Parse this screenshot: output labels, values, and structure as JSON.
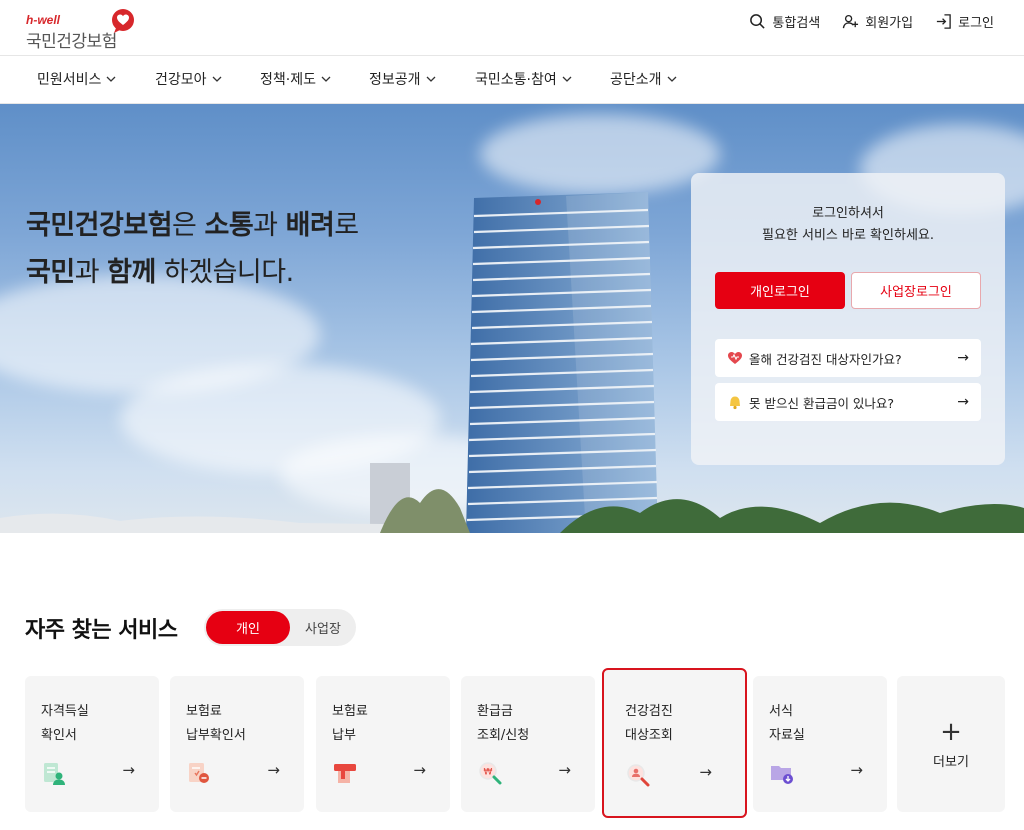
{
  "header": {
    "logo_en": "h-well",
    "logo_ko": "국민건강보험",
    "utility": [
      {
        "label": "통합검색",
        "icon": "search-icon"
      },
      {
        "label": "회원가입",
        "icon": "user-add-icon"
      },
      {
        "label": "로그인",
        "icon": "login-icon"
      }
    ]
  },
  "nav": [
    "민원서비스",
    "건강모아",
    "정책·제도",
    "정보공개",
    "국민소통·참여",
    "공단소개"
  ],
  "hero": {
    "line1": {
      "a": "국민건강보험",
      "b": "은 ",
      "c": "소통",
      "d": "과 ",
      "e": "배려",
      "f": "로"
    },
    "line2": {
      "a": "국민",
      "b": "과 ",
      "c": "함께",
      "d": " 하겠습니다."
    }
  },
  "login": {
    "msg1": "로그인하셔서",
    "msg2": "필요한 서비스 바로 확인하세요.",
    "personal": "개인로그인",
    "business": "사업장로그인",
    "quick": [
      {
        "label": "올해 건강검진 대상자인가요?",
        "icon": "heart-icon",
        "arrow": "→"
      },
      {
        "label": "못 받으신 환급금이 있나요?",
        "icon": "bell-icon",
        "arrow": "→"
      }
    ]
  },
  "services": {
    "title": "자주 찾는 서비스",
    "tab_personal": "개인",
    "tab_business": "사업장",
    "cards": [
      {
        "label": "자격득실\n확인서",
        "icon": "certificate-icon",
        "arrow": "→"
      },
      {
        "label": "보험료\n납부확인서",
        "icon": "receipt-icon",
        "arrow": "→"
      },
      {
        "label": "보험료\n납부",
        "icon": "payment-icon",
        "arrow": "→"
      },
      {
        "label": "환급금\n조회/신청",
        "icon": "refund-search-icon",
        "arrow": "→"
      },
      {
        "label": "건강검진\n대상조회",
        "icon": "checkup-search-icon",
        "arrow": "→"
      },
      {
        "label": "서식\n자료실",
        "icon": "folder-icon",
        "arrow": "→"
      }
    ],
    "more_plus": "+",
    "more_label": "더보기"
  },
  "colors": {
    "brand_red": "#e60012",
    "highlight_border": "#d8141e"
  }
}
